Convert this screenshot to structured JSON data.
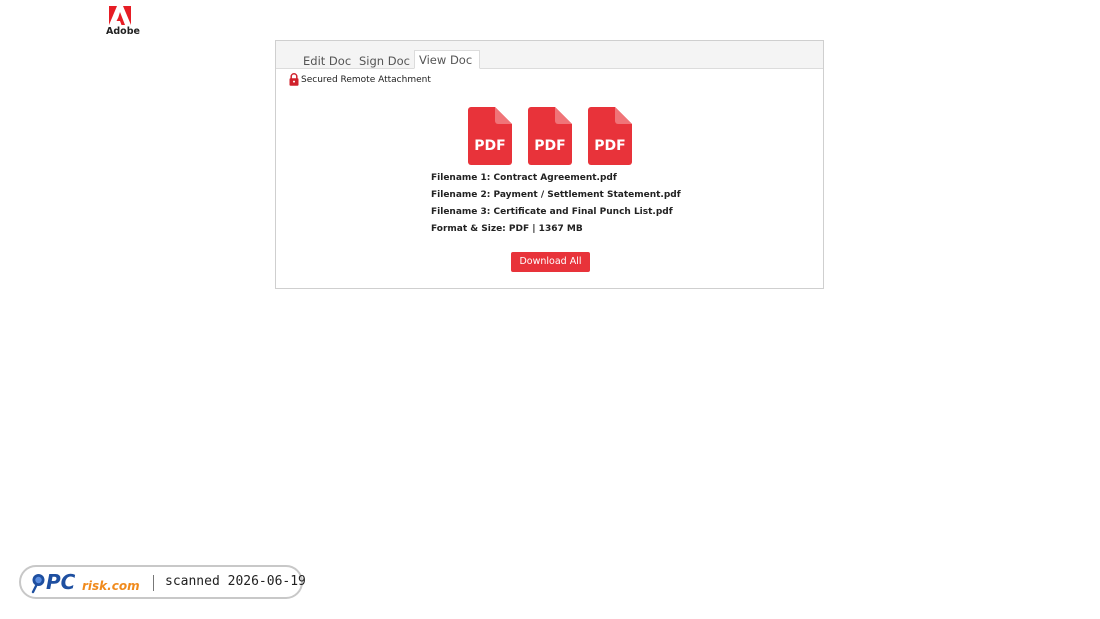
{
  "brand": {
    "logo_text": "Adobe",
    "color": "#e61d25"
  },
  "tabs": [
    {
      "label": "Edit Doc",
      "active": false
    },
    {
      "label": "Sign Doc",
      "active": false
    },
    {
      "label": "View Doc",
      "active": true
    }
  ],
  "secure": {
    "icon": "lock-icon",
    "label": "Secured Remote Attachment"
  },
  "files": {
    "icon": "pdf-icon",
    "icon_label": "PDF",
    "icon_color": "#e8333a",
    "lines": [
      "Filename 1: Contract Agreement.pdf",
      "Filename 2: Payment / Settlement Statement.pdf",
      "Filename 3: Certificate and Final Punch List.pdf",
      "Format & Size: PDF | 1367 MB"
    ]
  },
  "download": {
    "label": "Download All",
    "color": "#e8333a"
  },
  "watermark": {
    "logo_text_pc": "PC",
    "logo_text_risk": "risk.com",
    "scan_text": "scanned 2026-06-19"
  }
}
